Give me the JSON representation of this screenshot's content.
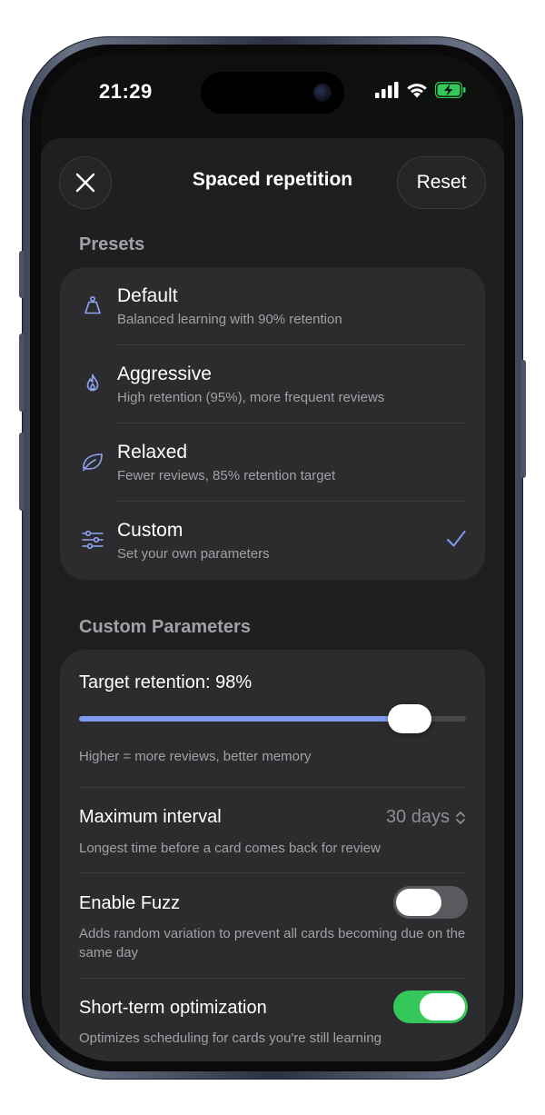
{
  "status_bar": {
    "time": "21:29",
    "icons": [
      "signal-icon",
      "wifi-icon",
      "battery-charging-icon"
    ],
    "battery_color": "#34c759"
  },
  "header": {
    "title": "Spaced repetition",
    "close_icon": "close-icon",
    "reset_label": "Reset"
  },
  "presets": {
    "section_title": "Presets",
    "items": [
      {
        "icon": "weight-icon",
        "title": "Default",
        "subtitle": "Balanced learning with 90% retention",
        "selected": false
      },
      {
        "icon": "flame-icon",
        "title": "Aggressive",
        "subtitle": "High retention (95%), more frequent reviews",
        "selected": false
      },
      {
        "icon": "leaf-icon",
        "title": "Relaxed",
        "subtitle": "Fewer reviews, 85% retention target",
        "selected": false
      },
      {
        "icon": "sliders-icon",
        "title": "Custom",
        "subtitle": "Set your own parameters",
        "selected": true
      }
    ]
  },
  "custom_parameters": {
    "section_title": "Custom Parameters",
    "target_retention": {
      "label": "Target retention: 98%",
      "value": 0.98,
      "help": "Higher = more reviews, better memory"
    },
    "maximum_interval": {
      "label": "Maximum interval",
      "value": "30 days",
      "help": "Longest time before a card comes back for review"
    },
    "enable_fuzz": {
      "label": "Enable Fuzz",
      "enabled": false,
      "help": "Adds random variation to prevent all cards becoming due on the same day"
    },
    "short_term_optimization": {
      "label": "Short-term optimization",
      "enabled": true,
      "help": "Optimizes scheduling for cards you're still learning"
    }
  },
  "colors": {
    "accent": "#7d9cf0",
    "toggle_on": "#34c759",
    "toggle_off": "#5a5a5e"
  }
}
